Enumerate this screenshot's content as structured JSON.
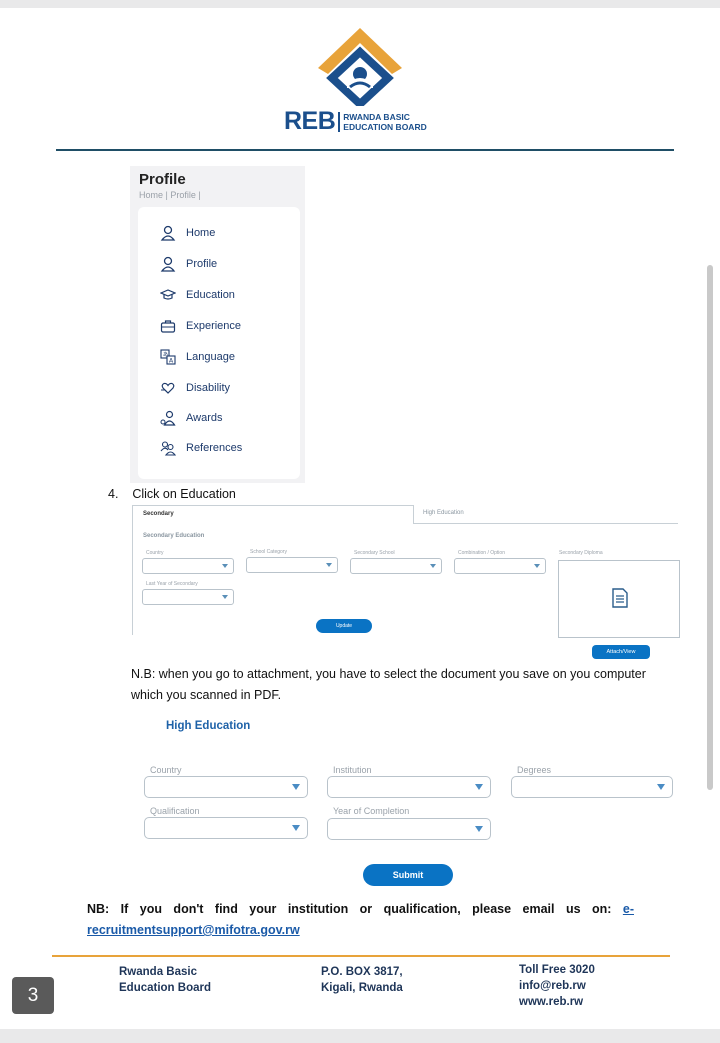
{
  "logo": {
    "reb": "REB",
    "line1": "RWANDA BASIC",
    "line2": "EDUCATION BOARD",
    "colors": {
      "orange": "#e8a33a",
      "blue": "#1b4f8c"
    }
  },
  "profile": {
    "title": "Profile",
    "breadcrumb": "Home | Profile |",
    "menu": [
      {
        "label": "Home",
        "icon": "user-icon"
      },
      {
        "label": "Profile",
        "icon": "user-icon"
      },
      {
        "label": "Education",
        "icon": "graduation-cap-icon"
      },
      {
        "label": "Experience",
        "icon": "briefcase-icon"
      },
      {
        "label": "Language",
        "icon": "translate-icon"
      },
      {
        "label": "Disability",
        "icon": "heart-hand-icon"
      },
      {
        "label": "Awards",
        "icon": "award-icon"
      },
      {
        "label": "References",
        "icon": "users-icon"
      }
    ]
  },
  "step": {
    "number": "4.",
    "text": "Click on Education"
  },
  "secondary_form": {
    "tabs": [
      "Secondary",
      "High Education"
    ],
    "heading": "Secondary Education",
    "fields": [
      "Country",
      "School Category",
      "Secondary School",
      "Combination / Option",
      "Secondary Diploma",
      "Last Year of Secondary"
    ],
    "update_label": "Update",
    "attach_label": "Attach/View"
  },
  "note1": "N.B: when you go to attachment, you have to select the document you save on you computer which you scanned in PDF.",
  "high_education": {
    "title": "High Education",
    "fields": [
      "Country",
      "Institution",
      "Degrees",
      "Qualification",
      "Year of Completion"
    ],
    "submit_label": "Submit"
  },
  "note2": {
    "text": "NB: If you don't find your institution or qualification, please email us on: ",
    "email": "e-recruitmentsupport@mifotra.gov.rw"
  },
  "footer": {
    "col1": [
      "Rwanda Basic",
      "Education Board"
    ],
    "col2": [
      "P.O. BOX 3817,",
      "Kigali, Rwanda"
    ],
    "col3": [
      "Toll Free 3020",
      "info@reb.rw",
      "www.reb.rw"
    ]
  },
  "page_number": "3"
}
